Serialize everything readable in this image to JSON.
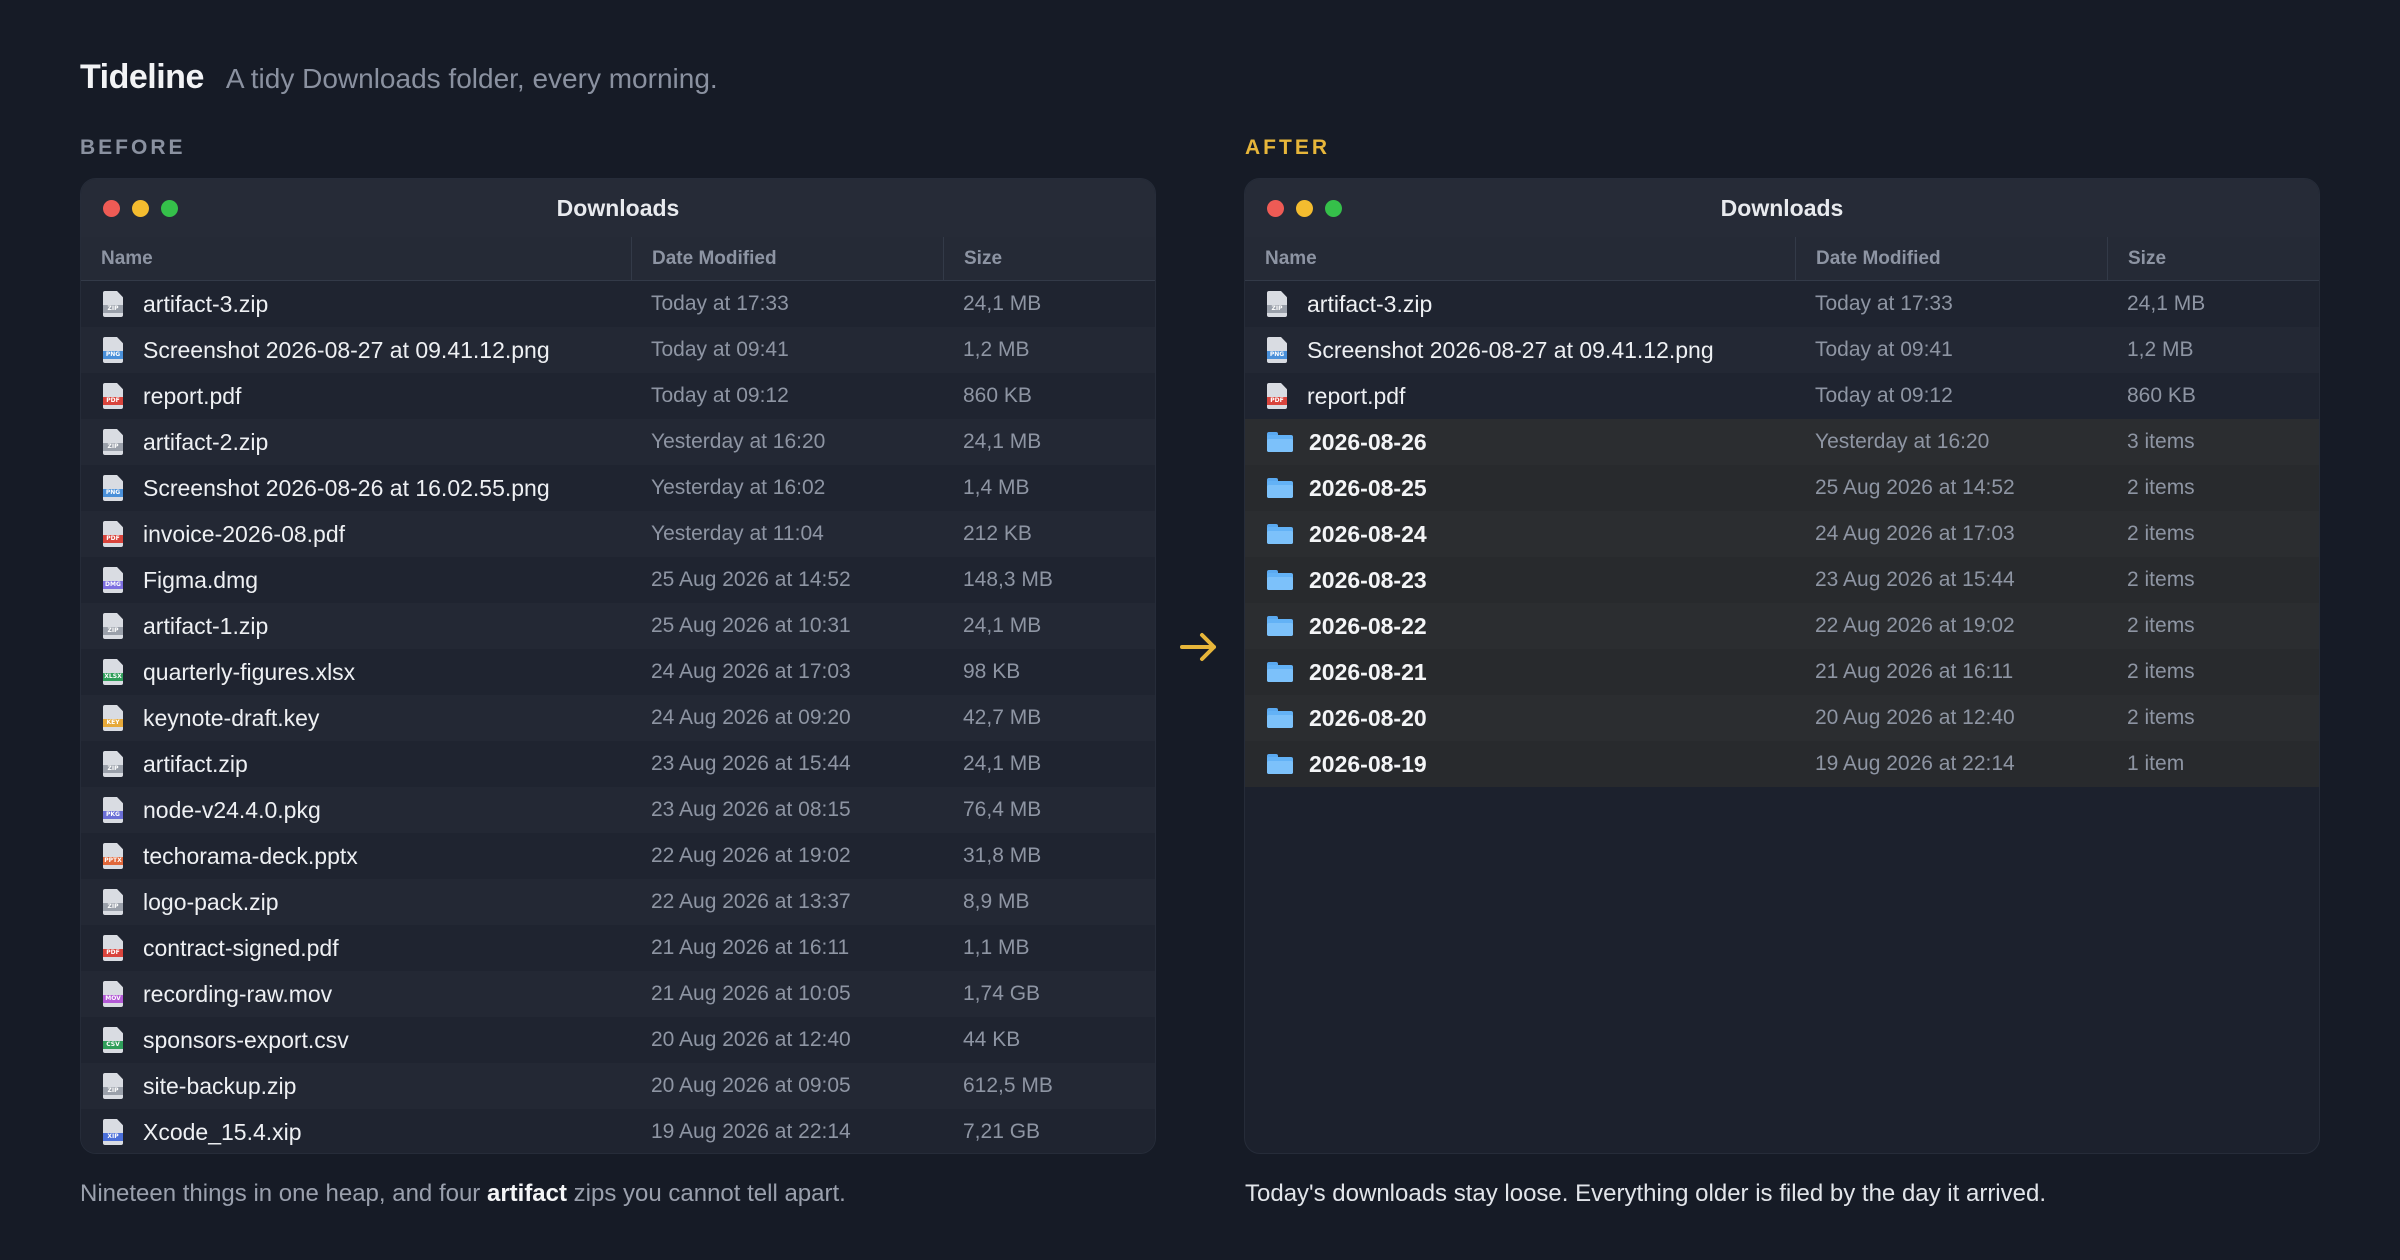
{
  "header": {
    "brand": "Tideline",
    "tagline": "A tidy Downloads folder, every morning."
  },
  "sections": {
    "before_label": "BEFORE",
    "after_label": "AFTER"
  },
  "colors": {
    "accent": "#e7b63a",
    "folder": "#63b2f6",
    "traffic_red": "#ee5b55",
    "traffic_yellow": "#f4bc2f",
    "traffic_green": "#35c04a"
  },
  "columns": {
    "name": "Name",
    "date": "Date Modified",
    "size": "Size"
  },
  "before": {
    "title": "Downloads",
    "rows": [
      {
        "name": "artifact-3.zip",
        "date": "Today at 17:33",
        "size": "24,1 MB",
        "tag": "ZIP",
        "color": "#9aa0aa"
      },
      {
        "name": "Screenshot 2026-08-27 at 09.41.12.png",
        "date": "Today at 09:41",
        "size": "1,2 MB",
        "tag": "PNG",
        "color": "#4a90d9"
      },
      {
        "name": "report.pdf",
        "date": "Today at 09:12",
        "size": "860 KB",
        "tag": "PDF",
        "color": "#d9443c"
      },
      {
        "name": "artifact-2.zip",
        "date": "Yesterday at 16:20",
        "size": "24,1 MB",
        "tag": "ZIP",
        "color": "#9aa0aa"
      },
      {
        "name": "Screenshot 2026-08-26 at 16.02.55.png",
        "date": "Yesterday at 16:02",
        "size": "1,4 MB",
        "tag": "PNG",
        "color": "#4a90d9"
      },
      {
        "name": "invoice-2026-08.pdf",
        "date": "Yesterday at 11:04",
        "size": "212 KB",
        "tag": "PDF",
        "color": "#d9443c"
      },
      {
        "name": "Figma.dmg",
        "date": "25 Aug 2026 at 14:52",
        "size": "148,3 MB",
        "tag": "DMG",
        "color": "#7d6fe0"
      },
      {
        "name": "artifact-1.zip",
        "date": "25 Aug 2026 at 10:31",
        "size": "24,1 MB",
        "tag": "ZIP",
        "color": "#9aa0aa"
      },
      {
        "name": "quarterly-figures.xlsx",
        "date": "24 Aug 2026 at 17:03",
        "size": "98 KB",
        "tag": "XLSX",
        "color": "#2f9e5a"
      },
      {
        "name": "keynote-draft.key",
        "date": "24 Aug 2026 at 09:20",
        "size": "42,7 MB",
        "tag": "KEY",
        "color": "#e6a93a"
      },
      {
        "name": "artifact.zip",
        "date": "23 Aug 2026 at 15:44",
        "size": "24,1 MB",
        "tag": "ZIP",
        "color": "#9aa0aa"
      },
      {
        "name": "node-v24.4.0.pkg",
        "date": "23 Aug 2026 at 08:15",
        "size": "76,4 MB",
        "tag": "PKG",
        "color": "#6b6fd6"
      },
      {
        "name": "techorama-deck.pptx",
        "date": "22 Aug 2026 at 19:02",
        "size": "31,8 MB",
        "tag": "PPTX",
        "color": "#e0673a"
      },
      {
        "name": "logo-pack.zip",
        "date": "22 Aug 2026 at 13:37",
        "size": "8,9 MB",
        "tag": "ZIP",
        "color": "#9aa0aa"
      },
      {
        "name": "contract-signed.pdf",
        "date": "21 Aug 2026 at 16:11",
        "size": "1,1 MB",
        "tag": "PDF",
        "color": "#d9443c"
      },
      {
        "name": "recording-raw.mov",
        "date": "21 Aug 2026 at 10:05",
        "size": "1,74 GB",
        "tag": "MOV",
        "color": "#b35ad6"
      },
      {
        "name": "sponsors-export.csv",
        "date": "20 Aug 2026 at 12:40",
        "size": "44 KB",
        "tag": "CSV",
        "color": "#2f9e5a"
      },
      {
        "name": "site-backup.zip",
        "date": "20 Aug 2026 at 09:05",
        "size": "612,5 MB",
        "tag": "ZIP",
        "color": "#9aa0aa"
      },
      {
        "name": "Xcode_15.4.xip",
        "date": "19 Aug 2026 at 22:14",
        "size": "7,21 GB",
        "tag": "XIP",
        "color": "#4a6fd9"
      }
    ]
  },
  "after": {
    "title": "Downloads",
    "rows": [
      {
        "name": "artifact-3.zip",
        "date": "Today at 17:33",
        "size": "24,1 MB",
        "tag": "ZIP",
        "color": "#9aa0aa"
      },
      {
        "name": "Screenshot 2026-08-27 at 09.41.12.png",
        "date": "Today at 09:41",
        "size": "1,2 MB",
        "tag": "PNG",
        "color": "#4a90d9"
      },
      {
        "name": "report.pdf",
        "date": "Today at 09:12",
        "size": "860 KB",
        "tag": "PDF",
        "color": "#d9443c"
      },
      {
        "name": "2026-08-26",
        "date": "Yesterday at 16:20",
        "size": "3 items",
        "folder": true
      },
      {
        "name": "2026-08-25",
        "date": "25 Aug 2026 at 14:52",
        "size": "2 items",
        "folder": true
      },
      {
        "name": "2026-08-24",
        "date": "24 Aug 2026 at 17:03",
        "size": "2 items",
        "folder": true
      },
      {
        "name": "2026-08-23",
        "date": "23 Aug 2026 at 15:44",
        "size": "2 items",
        "folder": true
      },
      {
        "name": "2026-08-22",
        "date": "22 Aug 2026 at 19:02",
        "size": "2 items",
        "folder": true
      },
      {
        "name": "2026-08-21",
        "date": "21 Aug 2026 at 16:11",
        "size": "2 items",
        "folder": true
      },
      {
        "name": "2026-08-20",
        "date": "20 Aug 2026 at 12:40",
        "size": "2 items",
        "folder": true
      },
      {
        "name": "2026-08-19",
        "date": "19 Aug 2026 at 22:14",
        "size": "1 item",
        "folder": true
      }
    ]
  },
  "captions": {
    "before_pre": "Nineteen things in one heap, and four ",
    "before_bold": "artifact",
    "before_post": " zips you cannot tell apart.",
    "after": "Today's downloads stay loose. Everything older is filed by the day it arrived."
  }
}
